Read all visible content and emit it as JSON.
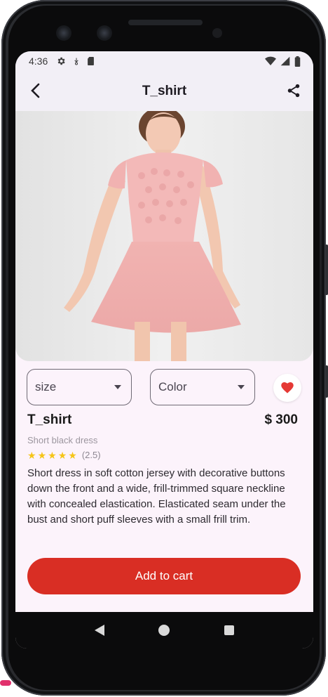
{
  "status_bar": {
    "time": "4:36",
    "icons": [
      "gear-icon",
      "download-icon",
      "sim-card-icon"
    ],
    "right_icons": [
      "wifi-icon",
      "signal-icon",
      "battery-icon"
    ]
  },
  "app_bar": {
    "title": "T_shirt",
    "back_icon": "arrow-back-icon",
    "share_icon": "share-icon"
  },
  "product": {
    "image_description": "dress-photo",
    "size_dropdown": {
      "value": "size"
    },
    "color_dropdown": {
      "value": "Color"
    },
    "favorite_icon": "heart-icon",
    "name": "T_shirt",
    "price": "$ 300",
    "subtitle": "Short black dress",
    "rating": {
      "stars": 5,
      "value_label": "(2.5)"
    },
    "description": "Short dress in soft cotton jersey with decorative buttons down the front and a wide, frill-trimmed square neckline with concealed elastication. Elasticated seam under the bust and short puff sleeves with a small frill trim."
  },
  "actions": {
    "add_to_cart": "Add to cart"
  },
  "colors": {
    "accent": "#d92e24",
    "background": "#fcf3fb",
    "heart": "#e53935",
    "star": "#f5c518"
  }
}
